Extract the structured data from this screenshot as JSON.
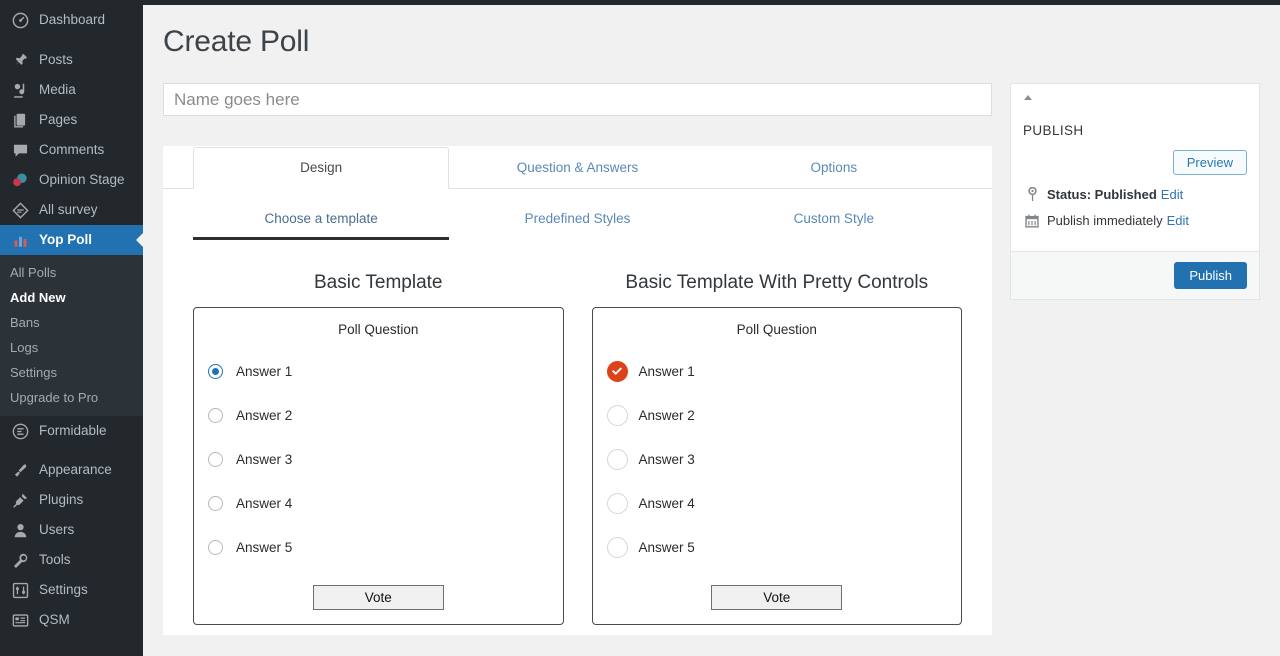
{
  "sidebar": {
    "items": [
      {
        "label": "Dashboard",
        "icon": "dashboard-icon",
        "name": "dashboard"
      },
      {
        "label": "Posts",
        "icon": "pin-icon",
        "name": "posts"
      },
      {
        "label": "Media",
        "icon": "media-icon",
        "name": "media"
      },
      {
        "label": "Pages",
        "icon": "pages-icon",
        "name": "pages"
      },
      {
        "label": "Comments",
        "icon": "comment-icon",
        "name": "comments"
      },
      {
        "label": "Opinion Stage",
        "icon": "opinion-stage-icon",
        "name": "opinion-stage"
      },
      {
        "label": "All survey",
        "icon": "survey-icon",
        "name": "all-survey"
      },
      {
        "label": "Yop Poll",
        "icon": "yop-poll-icon",
        "name": "yop-poll",
        "active": true
      }
    ],
    "submenu": [
      {
        "label": "All Polls",
        "name": "all-polls"
      },
      {
        "label": "Add New",
        "name": "add-new",
        "current": true
      },
      {
        "label": "Bans",
        "name": "bans"
      },
      {
        "label": "Logs",
        "name": "logs"
      },
      {
        "label": "Settings",
        "name": "settings"
      },
      {
        "label": "Upgrade to Pro",
        "name": "upgrade-to-pro"
      }
    ],
    "items_after": [
      {
        "label": "Formidable",
        "icon": "formidable-icon",
        "name": "formidable"
      },
      {
        "label": "Appearance",
        "icon": "appearance-icon",
        "name": "appearance"
      },
      {
        "label": "Plugins",
        "icon": "plugins-icon",
        "name": "plugins"
      },
      {
        "label": "Users",
        "icon": "users-icon",
        "name": "users"
      },
      {
        "label": "Tools",
        "icon": "tools-icon",
        "name": "tools"
      },
      {
        "label": "Settings",
        "icon": "settings-icon",
        "name": "settings-main"
      },
      {
        "label": "QSM",
        "icon": "qsm-icon",
        "name": "qsm"
      }
    ]
  },
  "page": {
    "title": "Create Poll"
  },
  "poll_name": {
    "value": "",
    "placeholder": "Name goes here"
  },
  "tabs": [
    {
      "label": "Design",
      "name": "design",
      "active": true
    },
    {
      "label": "Question & Answers",
      "name": "question-answers",
      "active": false
    },
    {
      "label": "Options",
      "name": "options",
      "active": false
    }
  ],
  "subtabs": [
    {
      "label": "Choose a template",
      "name": "choose-a-template",
      "active": true
    },
    {
      "label": "Predefined Styles",
      "name": "predefined-styles",
      "active": false
    },
    {
      "label": "Custom Style",
      "name": "custom-style",
      "active": false
    }
  ],
  "templates": [
    {
      "title": "Basic Template",
      "name": "basic-template",
      "question": "Poll Question",
      "control_style": "plain",
      "answers": [
        "Answer 1",
        "Answer 2",
        "Answer 3",
        "Answer 4",
        "Answer 5"
      ],
      "selected_index": 0,
      "vote_label": "Vote",
      "accent": "#1e72b5"
    },
    {
      "title": "Basic Template With Pretty Controls",
      "name": "basic-template-pretty-controls",
      "question": "Poll Question",
      "control_style": "pretty",
      "answers": [
        "Answer 1",
        "Answer 2",
        "Answer 3",
        "Answer 4",
        "Answer 5"
      ],
      "selected_index": 0,
      "vote_label": "Vote",
      "accent": "#dd4318"
    }
  ],
  "publish": {
    "heading": "PUBLISH",
    "preview_label": "Preview",
    "status_label": "Status: Published",
    "status_edit": "Edit",
    "schedule_label": "Publish immediately",
    "schedule_edit": "Edit",
    "publish_label": "Publish"
  },
  "colors": {
    "sidebar_bg": "#23282d",
    "submenu_bg": "#2c3338",
    "active_menu": "#2271b1",
    "link_blue": "#5b88b8",
    "button_blue": "#2271b1",
    "pretty_accent": "#dd4318",
    "plain_accent": "#1e72b5",
    "content_bg": "#f1f1f1"
  }
}
